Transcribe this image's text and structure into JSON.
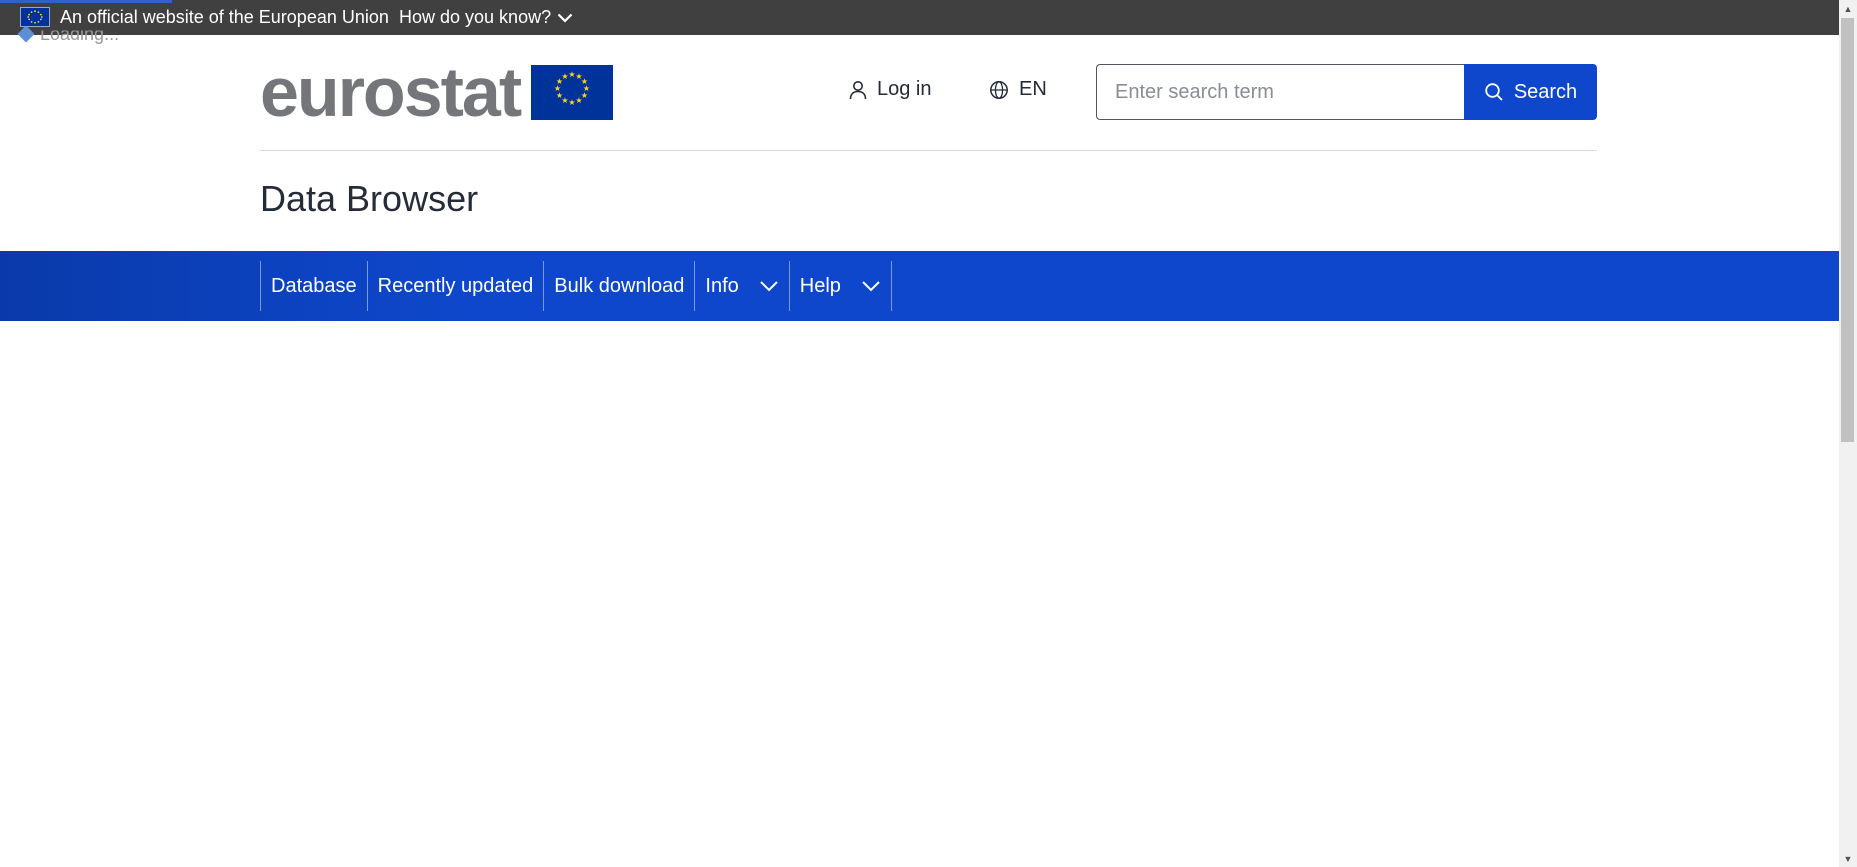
{
  "banner": {
    "official_text": "An official website of the European Union",
    "how_know_text": "How do you know?",
    "loading_text": "Loading..."
  },
  "header": {
    "logo_text": "eurostat",
    "login_label": "Log in",
    "language_label": "EN",
    "search": {
      "placeholder": "Enter search term",
      "value": "",
      "button_label": "Search"
    }
  },
  "page": {
    "title": "Data Browser"
  },
  "nav": {
    "items": [
      {
        "label": "Database",
        "has_dropdown": false
      },
      {
        "label": "Recently updated",
        "has_dropdown": false
      },
      {
        "label": "Bulk download",
        "has_dropdown": false
      },
      {
        "label": "Info",
        "has_dropdown": true
      },
      {
        "label": "Help",
        "has_dropdown": true
      }
    ]
  },
  "colors": {
    "banner_bg": "#404040",
    "primary_blue": "#0e47cb",
    "eu_flag_blue": "#003399",
    "eu_star_yellow": "#ffd617",
    "logo_gray": "#75767a",
    "text_dark": "#262b38"
  },
  "icons": {
    "banner_flag": "eu-flag-icon",
    "how_know_chevron": "chevron-down-icon",
    "login": "user-icon",
    "language": "globe-icon",
    "search": "search-icon",
    "nav_dropdown": "chevron-down-icon"
  }
}
